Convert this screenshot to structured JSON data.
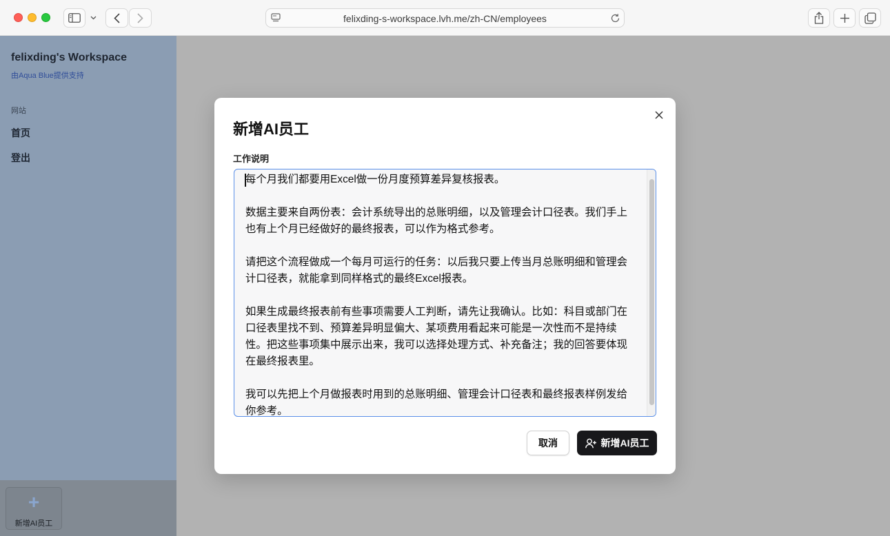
{
  "browser": {
    "url": "felixding-s-workspace.lvh.me/zh-CN/employees"
  },
  "sidebar": {
    "workspace_title": "felixding's Workspace",
    "powered_by": "由Aqua Blue提供支持",
    "section_label": "网站",
    "items": [
      {
        "label": "首页"
      },
      {
        "label": "登出"
      }
    ],
    "footer_button_label": "新增AI员工"
  },
  "modal": {
    "title": "新增AI员工",
    "field_label": "工作说明",
    "textarea_value": "每个月我们都要用Excel做一份月度预算差异复核报表。\n\n数据主要来自两份表：会计系统导出的总账明细，以及管理会计口径表。我们手上也有上个月已经做好的最终报表，可以作为格式参考。\n\n请把这个流程做成一个每月可运行的任务：以后我只要上传当月总账明细和管理会计口径表，就能拿到同样格式的最终Excel报表。\n\n如果生成最终报表前有些事项需要人工判断，请先让我确认。比如：科目或部门在口径表里找不到、预算差异明显偏大、某项费用看起来可能是一次性而不是持续性。把这些事项集中展示出来，我可以选择处理方式、补充备注；我的回答要体现在最终报表里。\n\n我可以先把上个月做报表时用到的总账明细、管理会计口径表和最终报表样例发给你参考。",
    "cancel_label": "取消",
    "submit_label": "新增AI员工"
  },
  "colors": {
    "accent": "#5a8fe8",
    "primary_button": "#18181b"
  }
}
